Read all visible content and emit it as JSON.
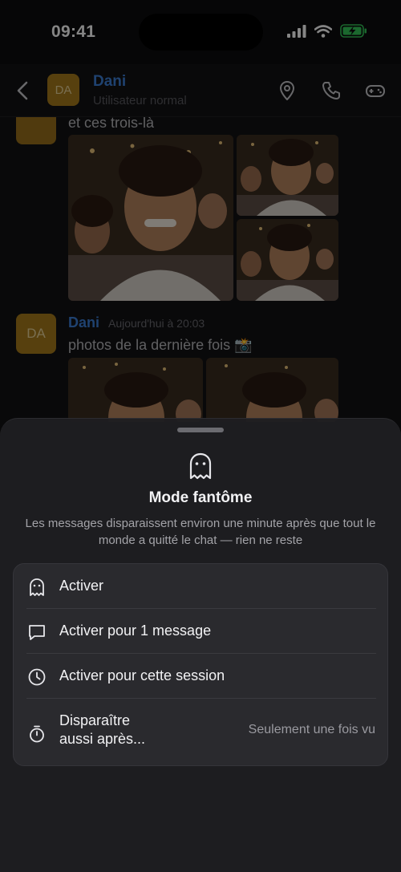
{
  "status_bar": {
    "time": "09:41"
  },
  "header": {
    "avatar_initials": "DA",
    "contact_name": "Dani",
    "contact_status": "Utilisateur normal",
    "icons": [
      "back-icon",
      "location-pin-icon",
      "phone-icon",
      "gamepad-icon"
    ]
  },
  "chat": {
    "message1_text": "et ces trois-là",
    "message2": {
      "avatar_initials": "DA",
      "sender": "Dani",
      "timestamp": "Aujourd'hui à 20:03",
      "text": "photos de la dernière fois 📸"
    }
  },
  "sheet": {
    "title": "Mode fantôme",
    "description": "Les messages disparaissent environ une minute après que tout le monde a quitté le chat — rien ne reste",
    "options": [
      {
        "label": "Activer",
        "icon": "ghost-icon"
      },
      {
        "label": "Activer pour 1 message",
        "icon": "message-bubble-icon"
      },
      {
        "label": "Activer pour cette session",
        "icon": "clock-icon"
      },
      {
        "label": "Disparaître\naussi après...",
        "icon": "timer-icon",
        "value": "Seulement une fois vu"
      }
    ]
  },
  "colors": {
    "accent": "#3d7fd6",
    "avatar": "#a87b1c",
    "sheet_bg": "#1e1e21",
    "options_bg": "#2a2a2e",
    "battery": "#34c759"
  }
}
